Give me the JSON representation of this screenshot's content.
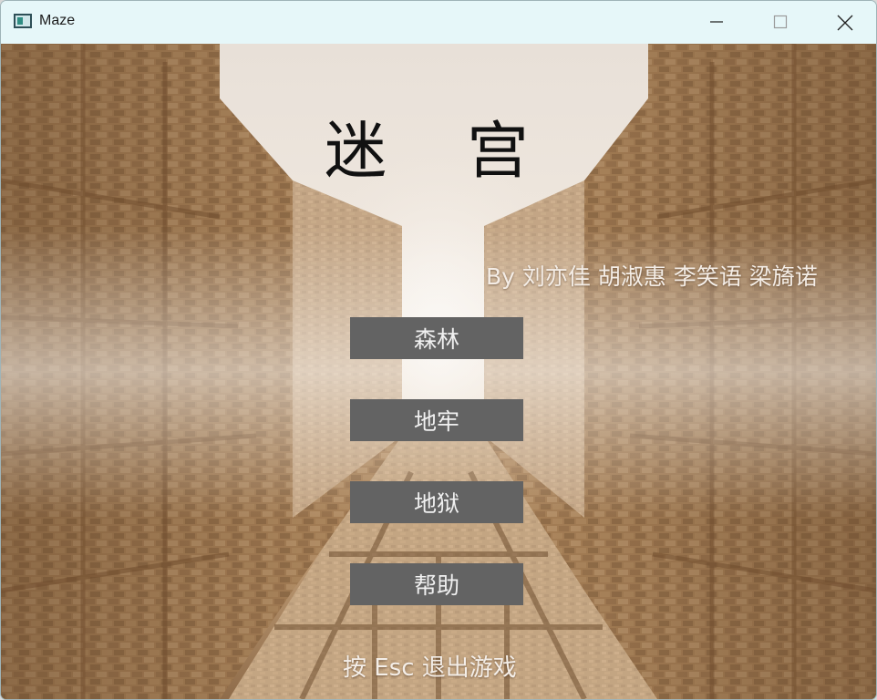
{
  "window": {
    "title": "Maze",
    "controls": {
      "minimize": "minimize-icon",
      "maximize": "maximize-icon",
      "close": "close-icon"
    }
  },
  "game": {
    "title": "迷宫",
    "credits": "By 刘亦佳 胡淑惠 李笑语 梁旖诺",
    "menu": [
      {
        "label": "森林"
      },
      {
        "label": "地牢"
      },
      {
        "label": "地狱"
      },
      {
        "label": "帮助"
      }
    ],
    "hint": "按 Esc 退出游戏"
  },
  "colors": {
    "button_bg": "#636363",
    "button_text": "#f0f0f0",
    "title_text": "#111111",
    "titlebar_bg": "#e6f7f9",
    "wall": "#a98259"
  }
}
